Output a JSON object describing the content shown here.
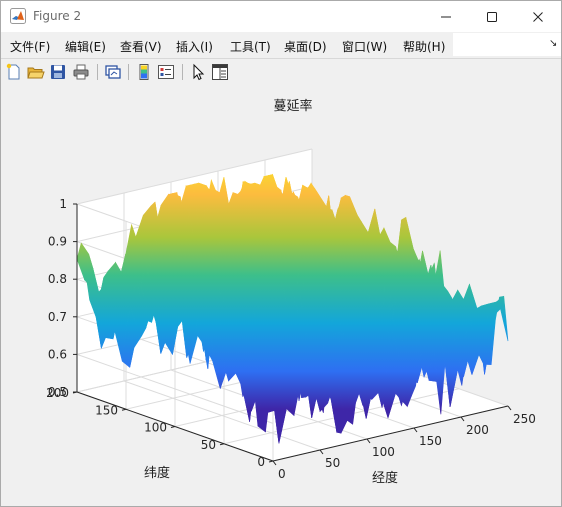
{
  "window": {
    "title": "Figure 2"
  },
  "menu": [
    "文件(F)",
    "编辑(E)",
    "查看(V)",
    "插入(I)",
    "工具(T)",
    "桌面(D)",
    "窗口(W)",
    "帮助(H)"
  ],
  "toolbar": {
    "buttons": [
      "new-figure-icon",
      "open-file-icon",
      "save-icon",
      "print-icon",
      "link-plot-icon",
      "insert-colorbar-icon",
      "insert-legend-icon",
      "edit-plot-icon",
      "property-inspector-icon"
    ]
  },
  "chart_data": {
    "type": "surface",
    "title": "蔓延率",
    "xlabel": "经度",
    "ylabel": "纬度",
    "zlabel": "",
    "x_ticks": [
      0,
      50,
      100,
      150,
      200,
      250
    ],
    "y_ticks": [
      0,
      50,
      100,
      150,
      200
    ],
    "z_ticks": [
      0.5,
      0.6,
      0.7,
      0.8,
      0.9,
      1
    ],
    "xlim": [
      0,
      250
    ],
    "ylim": [
      0,
      200
    ],
    "zlim": [
      0.5,
      1
    ],
    "colormap": "parula",
    "colors": [
      "#3e26a8",
      "#2e6ff2",
      "#13a6da",
      "#3dbf8a",
      "#a9c63c",
      "#fcbc3e",
      "#f9f820"
    ],
    "grid": true,
    "view": "3d default",
    "surface_profile": {
      "longitude": [
        0,
        25,
        50,
        75,
        100,
        125,
        150,
        175,
        200,
        225,
        250
      ],
      "latitude": [
        0,
        50,
        100,
        150,
        200
      ],
      "rate": [
        [
          0.7,
          0.66,
          0.74,
          0.62,
          0.69,
          0.57,
          0.6,
          0.66,
          0.72,
          0.68,
          0.75
        ],
        [
          0.74,
          0.72,
          0.78,
          0.7,
          0.63,
          0.76,
          0.71,
          0.67,
          0.8,
          0.73,
          0.7
        ],
        [
          0.79,
          0.85,
          0.76,
          0.88,
          0.8,
          0.91,
          0.84,
          0.78,
          0.87,
          0.82,
          0.79
        ],
        [
          0.72,
          0.8,
          0.86,
          0.79,
          0.92,
          0.85,
          0.94,
          0.88,
          0.9,
          0.83,
          0.76
        ],
        [
          0.8,
          0.69,
          0.83,
          0.9,
          0.86,
          0.98,
          0.91,
          0.96,
          0.89,
          0.81,
          0.74
        ]
      ]
    }
  }
}
